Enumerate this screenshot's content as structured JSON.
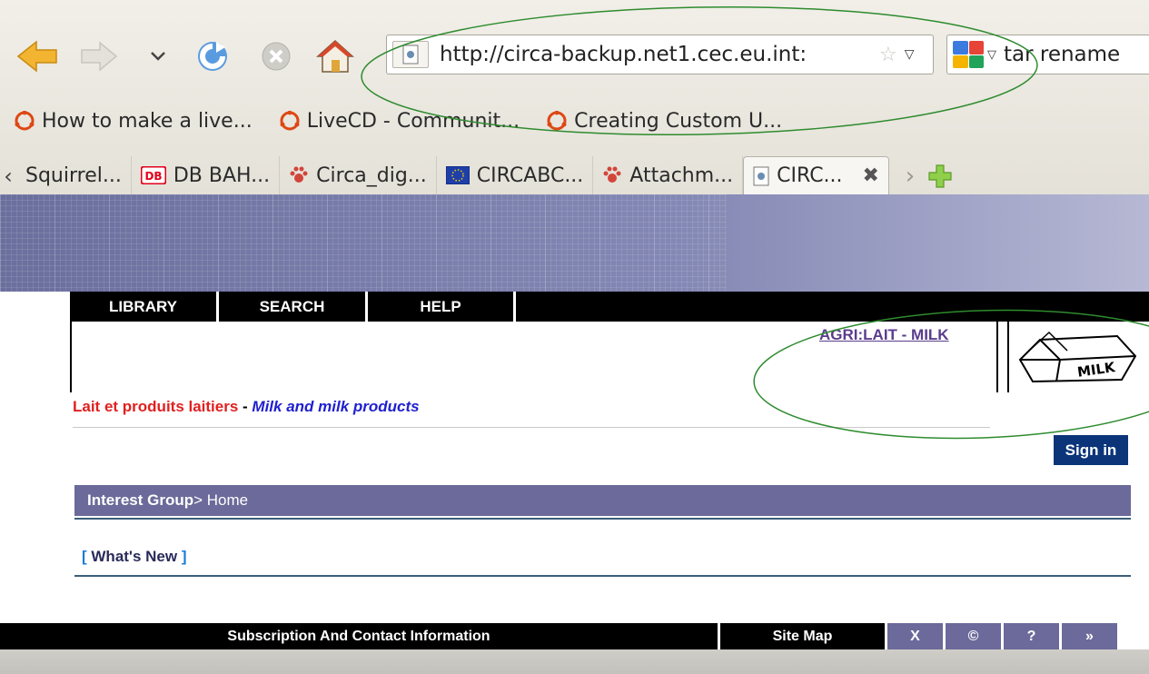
{
  "browser": {
    "url": "http://circa-backup.net1.cec.eu.int:",
    "search_text": "tar rename",
    "bookmarks": [
      {
        "label": "How to make a live..."
      },
      {
        "label": "LiveCD - Communit..."
      },
      {
        "label": "Creating Custom U..."
      }
    ],
    "tabs": [
      {
        "label": "Squirrel...",
        "icon": "scroll-left-chevron"
      },
      {
        "label": "DB BAH...",
        "icon": "db-icon",
        "badge": "DB"
      },
      {
        "label": "Circa_dig...",
        "icon": "paw-icon"
      },
      {
        "label": "CIRCABC...",
        "icon": "eu-flag-icon"
      },
      {
        "label": "Attachm...",
        "icon": "paw-icon"
      },
      {
        "label": "CIRC...",
        "icon": "page-icon",
        "active": true
      }
    ]
  },
  "site": {
    "menu": [
      "LIBRARY",
      "SEARCH",
      "HELP"
    ],
    "group_code": "AGRI:LAIT - MILK",
    "logo_text": "MILK",
    "title_fr": "Lait et produits laitiers",
    "title_sep": " - ",
    "title_en": "Milk and milk products",
    "signin": "Sign in",
    "breadcrumb_bold": "Interest Group",
    "breadcrumb_rest": " > Home",
    "whats_new_open": "[ ",
    "whats_new": "What's New",
    "whats_new_close": " ]",
    "footer": {
      "subscription": "Subscription And Contact Information",
      "sitemap": "Site Map",
      "x": "X",
      "copyright": "©",
      "help": "?",
      "more": "»"
    }
  },
  "colors": {
    "annotation_ellipse": "#2e8b2e",
    "menu_bg": "#000000",
    "breadcrumb_bg": "#6b6a9a",
    "signin_bg": "#0b3479",
    "title_fr": "#e02020",
    "title_en": "#2020d0"
  }
}
